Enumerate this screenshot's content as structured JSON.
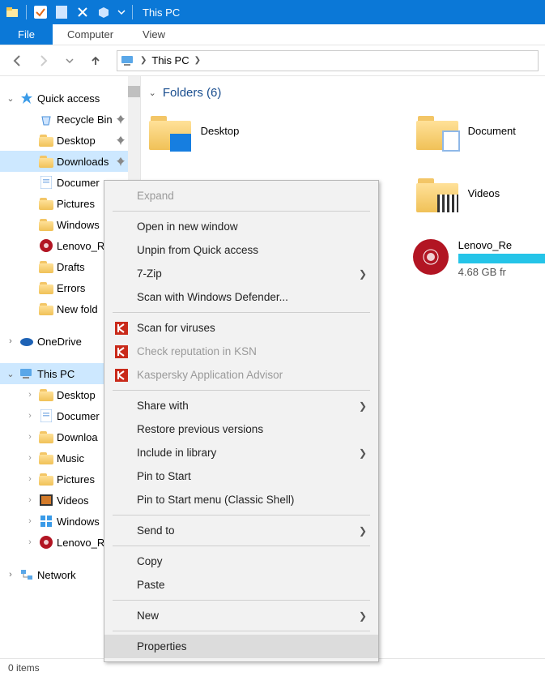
{
  "titlebar": {
    "title": "This PC"
  },
  "ribbon": {
    "file": "File",
    "computer": "Computer",
    "view": "View"
  },
  "address": {
    "location": "This PC"
  },
  "tree": {
    "quick_access": "Quick access",
    "qa_items": [
      {
        "label": "Recycle Bin",
        "pin": true,
        "ico": "recycle"
      },
      {
        "label": "Desktop",
        "pin": true,
        "ico": "folder"
      },
      {
        "label": "Downloads",
        "pin": true,
        "ico": "folder",
        "sel": true
      },
      {
        "label": "Documer",
        "pin": false,
        "ico": "doc"
      },
      {
        "label": "Pictures",
        "pin": false,
        "ico": "folder"
      },
      {
        "label": "Windows",
        "pin": false,
        "ico": "folder"
      },
      {
        "label": "Lenovo_R",
        "pin": false,
        "ico": "lenovo"
      },
      {
        "label": "Drafts",
        "pin": false,
        "ico": "folder"
      },
      {
        "label": "Errors",
        "pin": false,
        "ico": "folder"
      },
      {
        "label": "New fold",
        "pin": false,
        "ico": "folder"
      }
    ],
    "onedrive": "OneDrive",
    "thispc": "This PC",
    "pc_items": [
      {
        "label": "Desktop",
        "ico": "folder"
      },
      {
        "label": "Documer",
        "ico": "doc"
      },
      {
        "label": "Downloa",
        "ico": "folder"
      },
      {
        "label": "Music",
        "ico": "folder"
      },
      {
        "label": "Pictures",
        "ico": "folder"
      },
      {
        "label": "Videos",
        "ico": "video"
      },
      {
        "label": "Windows",
        "ico": "win"
      },
      {
        "label": "Lenovo_R",
        "ico": "lenovo"
      }
    ],
    "network": "Network"
  },
  "content": {
    "folders_header": "Folders (6)",
    "folders": [
      {
        "label": "Desktop",
        "overlay": "desktop"
      },
      {
        "label": "Document",
        "overlay": "doc"
      },
      {
        "label": "Videos",
        "overlay": "video"
      }
    ],
    "drive": {
      "label": "Lenovo_Re",
      "free": "4.68 GB fr"
    }
  },
  "ctx": {
    "items": [
      {
        "label": "Expand",
        "disabled": true
      },
      {
        "sep": true
      },
      {
        "label": "Open in new window"
      },
      {
        "label": "Unpin from Quick access"
      },
      {
        "label": "7-Zip",
        "sub": true
      },
      {
        "label": "Scan with Windows Defender..."
      },
      {
        "sep": true
      },
      {
        "label": "Scan for viruses",
        "ico": "k"
      },
      {
        "label": "Check reputation in KSN",
        "ico": "k",
        "disabled": true
      },
      {
        "label": "Kaspersky Application Advisor",
        "ico": "k",
        "disabled": true
      },
      {
        "sep": true
      },
      {
        "label": "Share with",
        "sub": true
      },
      {
        "label": "Restore previous versions"
      },
      {
        "label": "Include in library",
        "sub": true
      },
      {
        "label": "Pin to Start"
      },
      {
        "label": "Pin to Start menu (Classic Shell)"
      },
      {
        "sep": true
      },
      {
        "label": "Send to",
        "sub": true
      },
      {
        "sep": true
      },
      {
        "label": "Copy"
      },
      {
        "label": "Paste"
      },
      {
        "sep": true
      },
      {
        "label": "New",
        "sub": true
      },
      {
        "sep": true
      },
      {
        "label": "Properties",
        "hl": true
      }
    ]
  },
  "status": {
    "text": "0 items"
  }
}
